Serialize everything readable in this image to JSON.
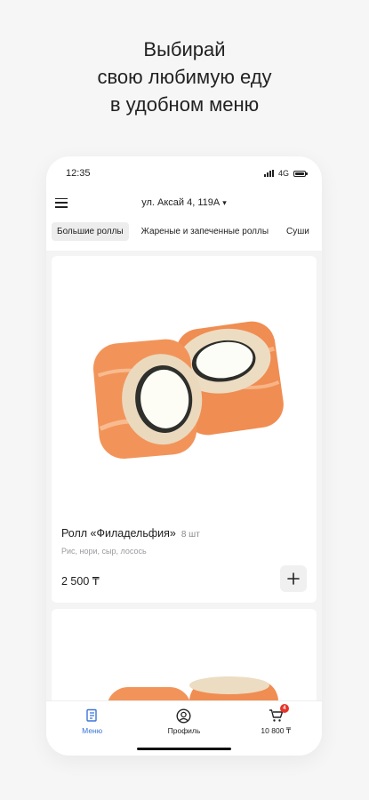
{
  "promo": {
    "line1": "Выбирай",
    "line2": "свою любимую еду",
    "line3": "в удобном меню"
  },
  "status_bar": {
    "time": "12:35",
    "network": "4G"
  },
  "header": {
    "address": "ул. Аксай 4, 119А",
    "address_caret": "▾"
  },
  "categories": [
    {
      "label": "Большие роллы",
      "active": true
    },
    {
      "label": "Жареные и запеченные роллы",
      "active": false
    },
    {
      "label": "Суши",
      "active": false
    }
  ],
  "product": {
    "name": "Ролл «Филадельфия»",
    "quantity": "8 шт",
    "description": "Рис, нори, сыр, лосось",
    "price": "2 500 ₸",
    "add_label": "+"
  },
  "bottom_nav": {
    "menu_label": "Меню",
    "profile_label": "Профиль",
    "cart_label": "10 800 ₸",
    "cart_count": "4"
  },
  "colors": {
    "accent": "#3b74d8",
    "badge": "#e5342b",
    "salmon": "#f2945a"
  },
  "icons": [
    "menu-burger-icon",
    "signal-icon",
    "battery-icon",
    "plus-icon",
    "menu-icon",
    "profile-icon",
    "cart-icon"
  ]
}
